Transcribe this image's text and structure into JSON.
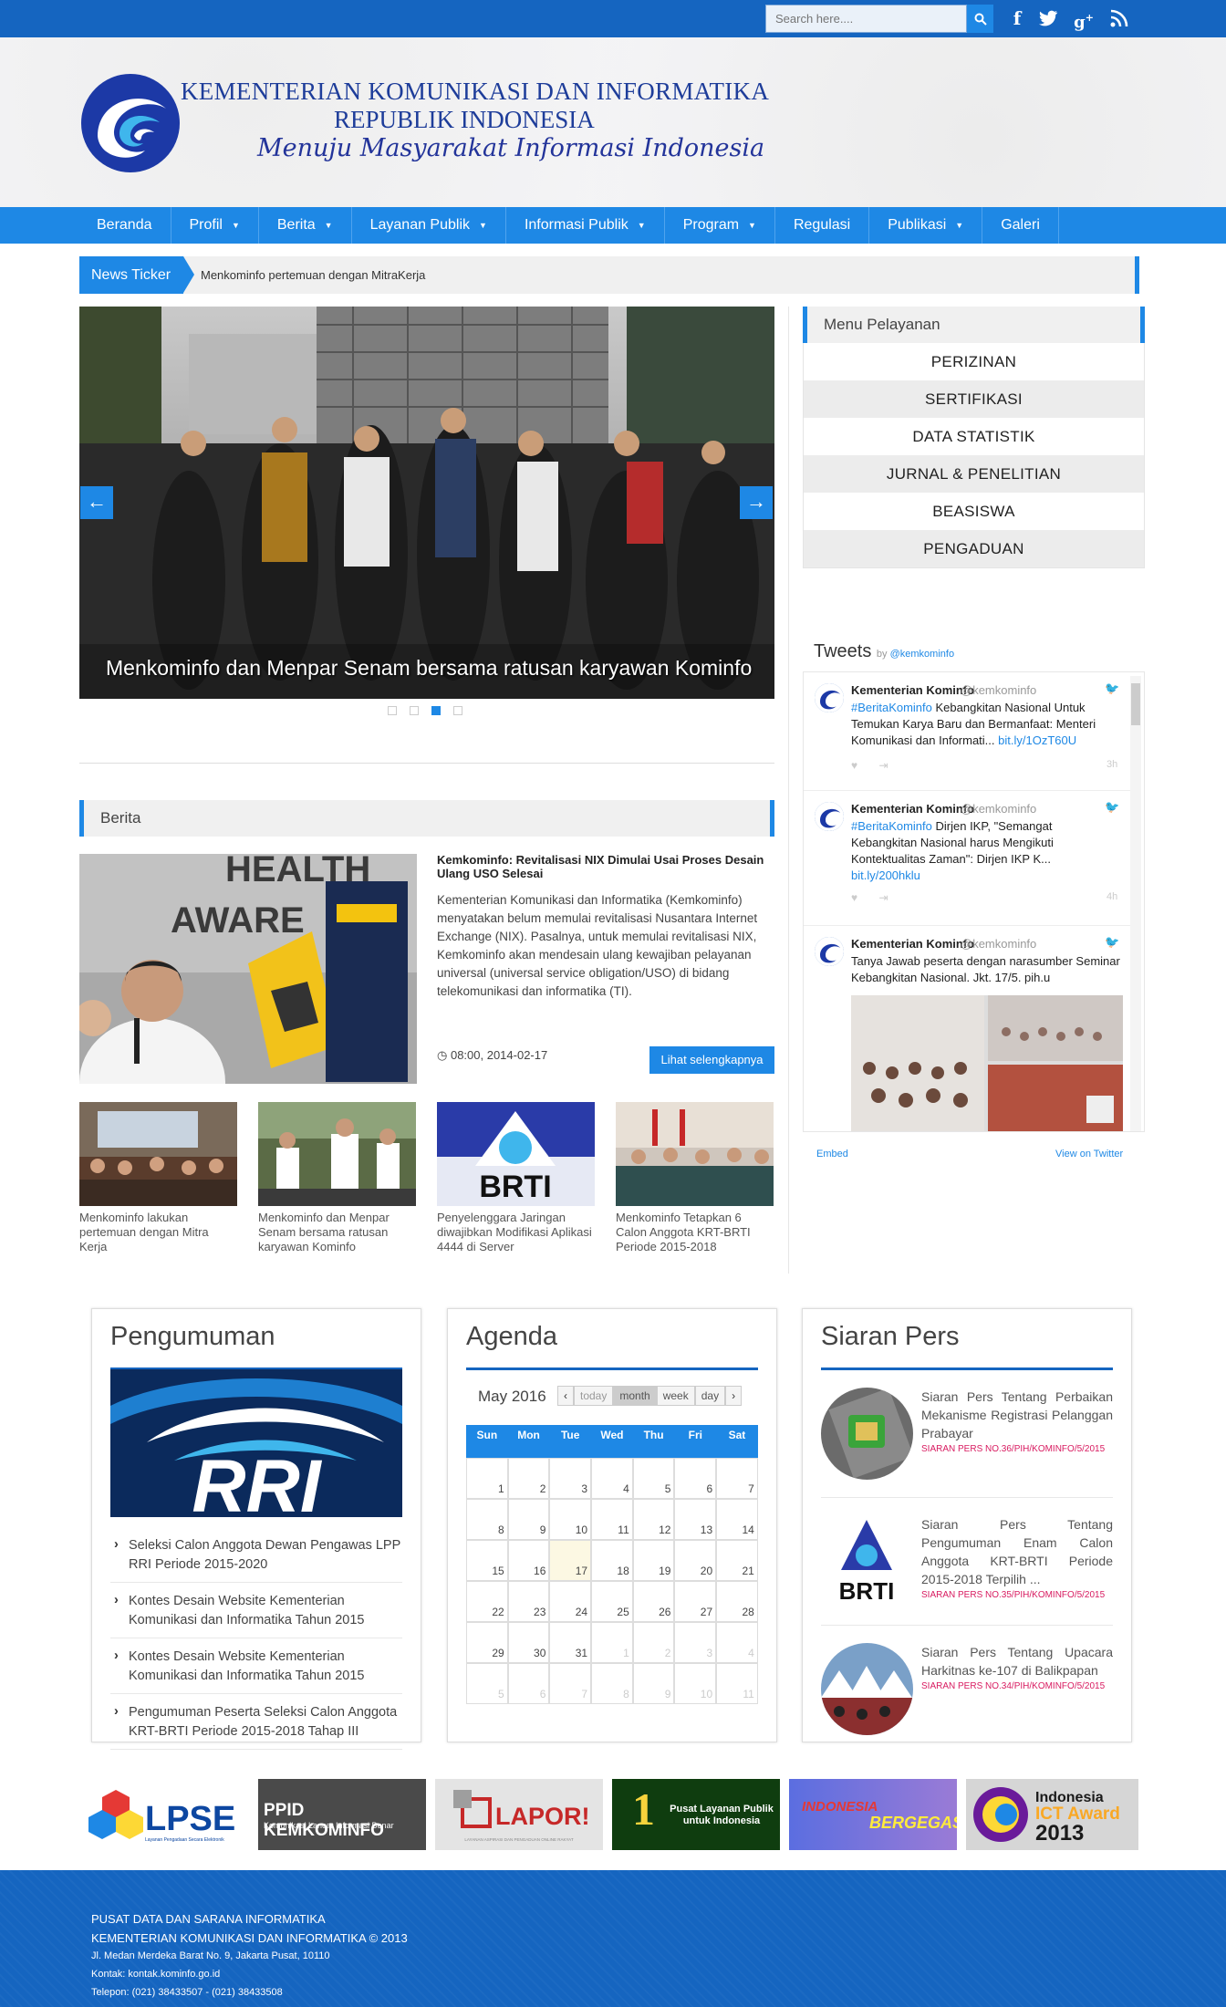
{
  "topbar": {
    "search_placeholder": "Search here....",
    "social_icons": [
      "facebook-icon",
      "twitter-icon",
      "google-plus-icon",
      "rss-icon"
    ]
  },
  "header": {
    "line1": "KEMENTERIAN KOMUNIKASI DAN INFORMATIKA",
    "line2": "REPUBLIK INDONESIA",
    "tagline": "Menuju Masyarakat Informasi Indonesia"
  },
  "nav": {
    "items": [
      {
        "label": "Beranda",
        "dropdown": false
      },
      {
        "label": "Profil",
        "dropdown": true
      },
      {
        "label": "Berita",
        "dropdown": true
      },
      {
        "label": "Layanan Publik",
        "dropdown": true
      },
      {
        "label": "Informasi Publik",
        "dropdown": true
      },
      {
        "label": "Program",
        "dropdown": true
      },
      {
        "label": "Regulasi",
        "dropdown": false
      },
      {
        "label": "Publikasi",
        "dropdown": true
      },
      {
        "label": "Galeri",
        "dropdown": false
      }
    ]
  },
  "ticker": {
    "label": "News Ticker",
    "text": "Menkominfo pertemuan dengan MitraKerja"
  },
  "slider": {
    "caption": "Menkominfo dan Menpar Senam bersama ratusan karyawan Kominfo",
    "active_slide": 3,
    "slide_count": 4
  },
  "menu_pelayanan": {
    "title": "Menu Pelayanan",
    "items": [
      "PERIZINAN",
      "SERTIFIKASI",
      "DATA STATISTIK",
      "JURNAL & PENELITIAN",
      "BEASISWA",
      "PENGADUAN"
    ]
  },
  "tweets": {
    "title": "Tweets",
    "by": "by",
    "handle": "@kemkominfo",
    "items": [
      {
        "name": "Kementerian Kominfo",
        "handle": "@kemkominfo",
        "tag": "#BeritaKominfo",
        "text": " Kebangkitan Nasional Untuk Temukan Karya Baru dan Bermanfaat: Menteri Komunikasi dan Informati...",
        "link": "bit.ly/1OzT60U",
        "time": "3h"
      },
      {
        "name": "Kementerian Kominfo",
        "handle": "@kemkominfo",
        "tag": "#BeritaKominfo",
        "text": " Dirjen IKP, \"Semangat Kebangkitan Nasional harus Mengikuti Kontektualitas Zaman\": Dirjen IKP K...",
        "link": "bit.ly/200hklu",
        "time": "4h"
      },
      {
        "name": "Kementerian Kominfo",
        "handle": "@kemkominfo",
        "tag": "",
        "text": "Tanya Jawab peserta dengan narasumber Seminar Kebangkitan Nasional. Jkt. 17/5. pih.u",
        "link": "",
        "time": ""
      }
    ],
    "embed": "Embed",
    "view_on_twitter": "View on Twitter"
  },
  "berita": {
    "title": "Berita",
    "main": {
      "title": "Kemkominfo: Revitalisasi NIX Dimulai Usai Proses Desain Ulang USO Selesai",
      "desc": "Kementerian Komunikasi dan Informatika (Kemkominfo) menyatakan belum memulai revitalisasi Nusantara Internet Exchange (NIX). Pasalnya, untuk memulai revitalisasi NIX, Kemkominfo akan mendesain ulang kewajiban pelayanan universal (universal service obligation/USO) di bidang telekomunikasi dan informatika (TI).",
      "date": "08:00, 2014-02-17",
      "more": "Lihat selengkapnya",
      "image_text_1": "HEALTH",
      "image_text_2": "AWARE"
    },
    "thumbs": [
      {
        "caption": "Menkominfo lakukan pertemuan dengan Mitra Kerja"
      },
      {
        "caption": "Menkominfo dan Menpar Senam bersama ratusan karyawan Kominfo"
      },
      {
        "caption": "Penyelenggara Jaringan diwajibkan Modifikasi Aplikasi 4444 di Server"
      },
      {
        "caption": "Menkominfo Tetapkan 6 Calon Anggota KRT-BRTI Periode 2015-2018"
      }
    ]
  },
  "pengumuman": {
    "title": "Pengumuman",
    "logo_text": "RRI",
    "items": [
      "Seleksi Calon Anggota Dewan Pengawas LPP RRI Periode 2015-2020",
      "Kontes Desain Website Kementerian Komunikasi dan Informatika Tahun 2015",
      "Kontes Desain Website Kementerian Komunikasi dan Informatika Tahun 2015",
      "Pengumuman Peserta Seleksi Calon Anggota KRT-BRTI Periode 2015-2018 Tahap III"
    ]
  },
  "agenda": {
    "title": "Agenda",
    "month": "May 2016",
    "buttons": {
      "prev": "‹",
      "today": "today",
      "month": "month",
      "week": "week",
      "day": "day",
      "next": "›"
    },
    "days": [
      "Sun",
      "Mon",
      "Tue",
      "Wed",
      "Thu",
      "Fri",
      "Sat"
    ],
    "weeks": [
      [
        {
          "d": "1"
        },
        {
          "d": "2"
        },
        {
          "d": "3"
        },
        {
          "d": "4"
        },
        {
          "d": "5"
        },
        {
          "d": "6"
        },
        {
          "d": "7"
        }
      ],
      [
        {
          "d": "8"
        },
        {
          "d": "9"
        },
        {
          "d": "10"
        },
        {
          "d": "11"
        },
        {
          "d": "12"
        },
        {
          "d": "13"
        },
        {
          "d": "14"
        }
      ],
      [
        {
          "d": "15"
        },
        {
          "d": "16"
        },
        {
          "d": "17",
          "today": true
        },
        {
          "d": "18"
        },
        {
          "d": "19"
        },
        {
          "d": "20"
        },
        {
          "d": "21"
        }
      ],
      [
        {
          "d": "22"
        },
        {
          "d": "23"
        },
        {
          "d": "24"
        },
        {
          "d": "25"
        },
        {
          "d": "26"
        },
        {
          "d": "27"
        },
        {
          "d": "28"
        }
      ],
      [
        {
          "d": "29"
        },
        {
          "d": "30"
        },
        {
          "d": "31"
        },
        {
          "d": "1",
          "other": true
        },
        {
          "d": "2",
          "other": true
        },
        {
          "d": "3",
          "other": true
        },
        {
          "d": "4",
          "other": true
        }
      ],
      [
        {
          "d": "5",
          "other": true
        },
        {
          "d": "6",
          "other": true
        },
        {
          "d": "7",
          "other": true
        },
        {
          "d": "8",
          "other": true
        },
        {
          "d": "9",
          "other": true
        },
        {
          "d": "10",
          "other": true
        },
        {
          "d": "11",
          "other": true
        }
      ]
    ]
  },
  "siaran_pers": {
    "title": "Siaran Pers",
    "items": [
      {
        "text": "Siaran Pers Tentang Perbaikan Mekanisme Registrasi Pelanggan Prabayar",
        "ref": "SIARAN PERS NO.36/PIH/KOMINFO/5/2015"
      },
      {
        "text": "Siaran Pers Tentang Pengumuman Enam Calon Anggota KRT-BRTI Periode 2015-2018 Terpilih ...",
        "ref": "SIARAN PERS NO.35/PIH/KOMINFO/5/2015",
        "logo": "BRTI"
      },
      {
        "text": "Siaran Pers Tentang Upacara Harkitnas ke-107 di Balikpapan",
        "ref": "SIARAN PERS NO.34/PIH/KOMINFO/5/2015"
      }
    ]
  },
  "banners": {
    "lpse": "LPSE",
    "lpse_sub": "Layanan Pengadaan Secara Elektronik",
    "ppid": "PPID KEMKOMINFO",
    "ppid_sub": "Komunikasi Lancar Informasi Benar",
    "lapor": "LAPOR!",
    "lapor_sub": "LAYANAN ASPIRASI DAN PENGADUAN ONLINE RAKYAT",
    "pusat_num": "1",
    "pusat": "Pusat Layanan Publik untuk Indonesia",
    "bergegas_1": "INDONESIA",
    "bergegas_2": "BERGEGAS",
    "ict_1": "Indonesia",
    "ict_2": "ICT Award",
    "ict_3": "2013"
  },
  "footer": {
    "line1": "PUSAT DATA DAN SARANA INFORMATIKA",
    "line2": "KEMENTERIAN KOMUNIKASI DAN INFORMATIKA © 2013",
    "line3": "Jl. Medan Merdeka Barat No. 9, Jakarta Pusat, 10110",
    "line4": "Kontak: kontak.kominfo.go.id",
    "line5": "Telepon: (021) 38433507 - (021) 38433508"
  },
  "colors": {
    "primary": "#1e88e5",
    "topbar": "#1565c0",
    "pink_ref": "#d81b60"
  }
}
